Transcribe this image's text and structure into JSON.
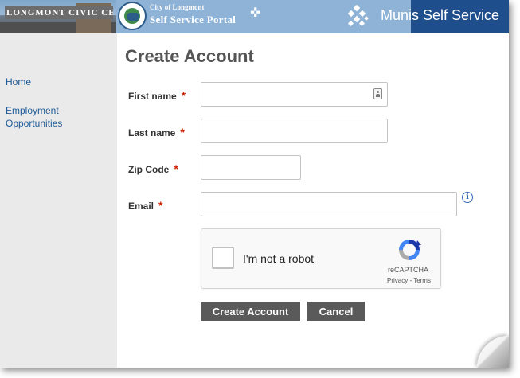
{
  "header": {
    "photo_sign": "LONGMONT CIVIC CENTER",
    "portal_small": "City of Longmont",
    "portal_big": "Self Service Portal",
    "app_title": "Munis Self Service"
  },
  "sidebar": {
    "items": [
      {
        "label": "Home"
      },
      {
        "label": "Employment Opportunities"
      }
    ]
  },
  "page": {
    "title": "Create Account"
  },
  "form": {
    "first_name": {
      "label": "First name",
      "value": "",
      "required": "*"
    },
    "last_name": {
      "label": "Last name",
      "value": "",
      "required": "*"
    },
    "zip_code": {
      "label": "Zip Code",
      "value": "",
      "required": "*"
    },
    "email": {
      "label": "Email",
      "value": "",
      "required": "*"
    },
    "info_icon_glyph": "i"
  },
  "captcha": {
    "label": "I'm not a robot",
    "brand": "reCAPTCHA",
    "links": "Privacy - Terms"
  },
  "buttons": {
    "create": "Create Account",
    "cancel": "Cancel"
  },
  "colors": {
    "header_blue": "#1f4e8c",
    "link_blue": "#1e5a96",
    "button_gray": "#5a5a5a",
    "required_red": "#cc2200"
  }
}
